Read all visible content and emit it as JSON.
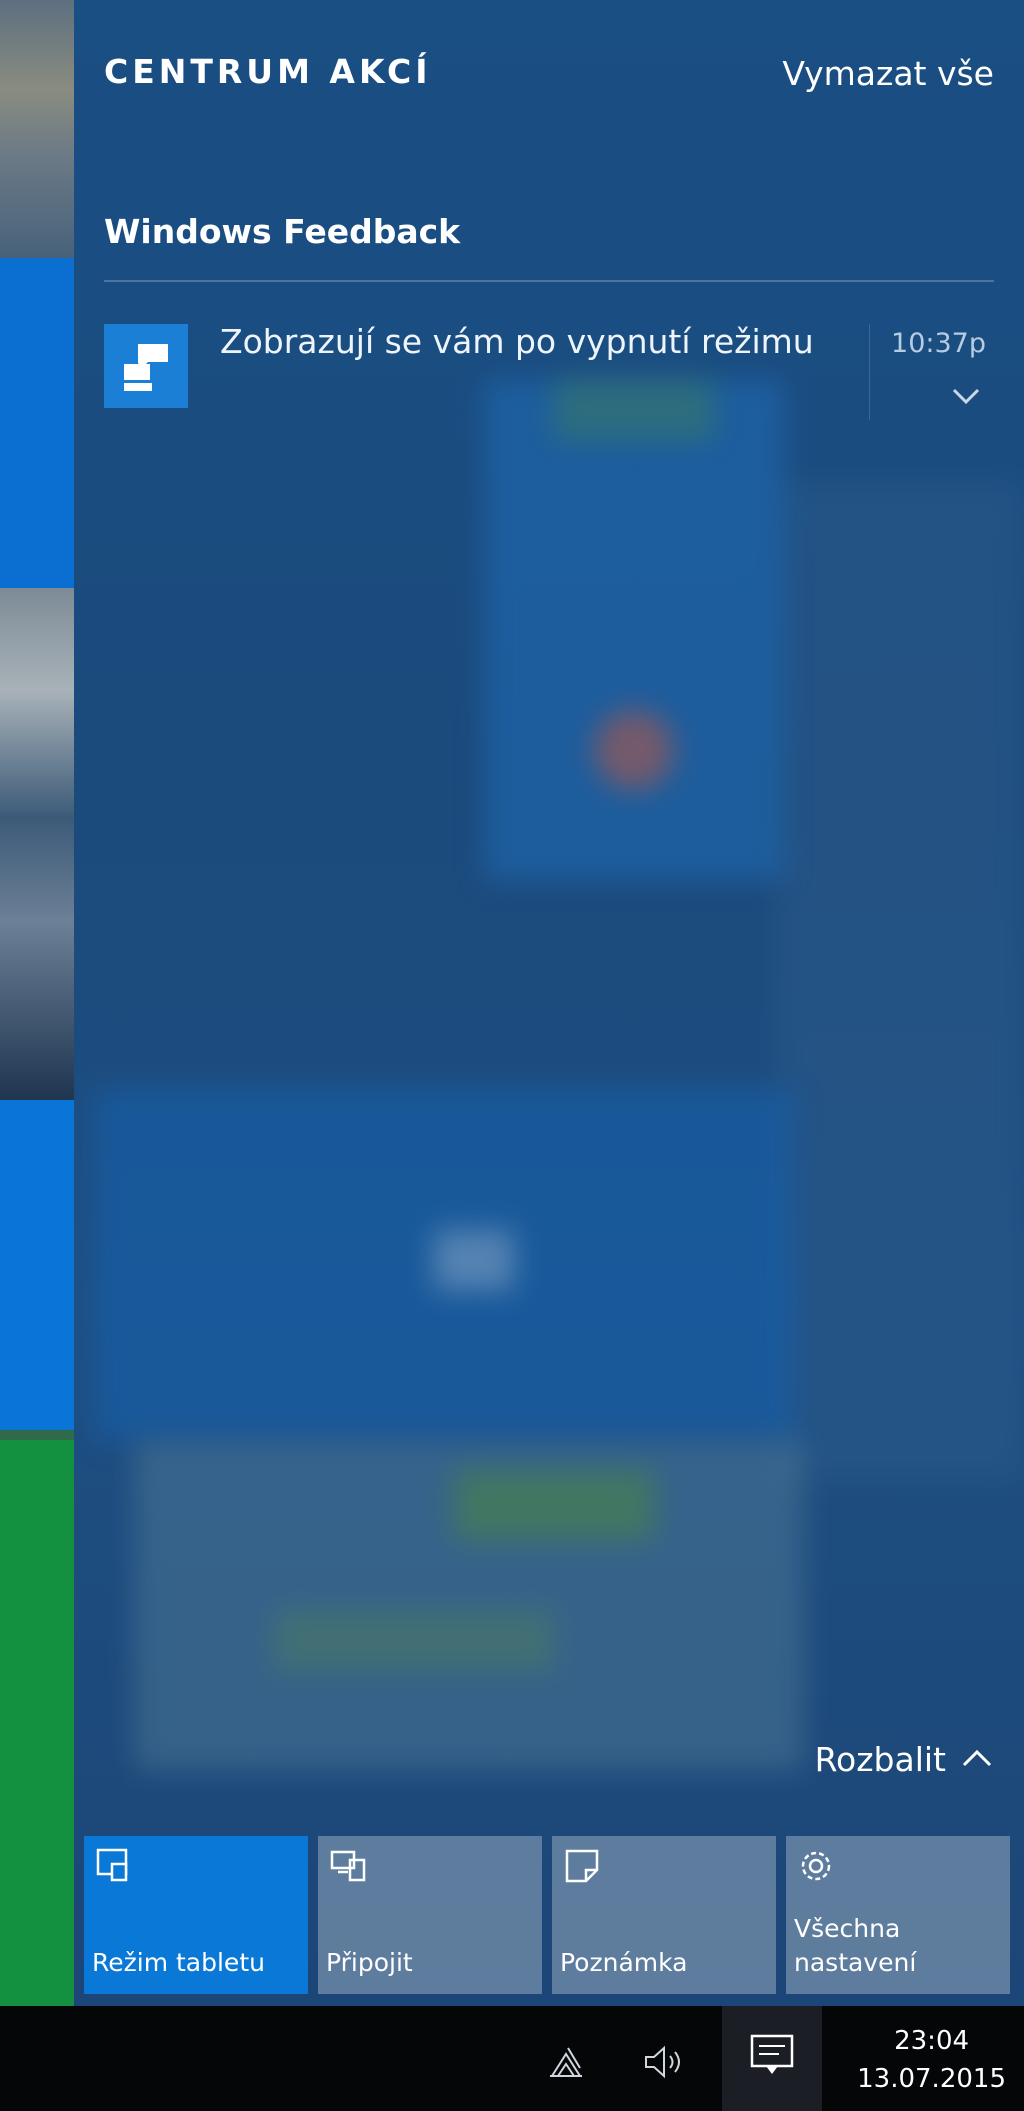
{
  "action_center": {
    "title": "CENTRUM AKCÍ",
    "clear_all_label": "Vymazat vše",
    "groups": [
      {
        "app_name": "Windows Feedback",
        "app_icon": "windows-feedback-icon",
        "notifications": [
          {
            "text": "Zobrazují se vám po vypnutí režimu",
            "time": "10:37p",
            "expand_icon": "chevron-down-icon"
          }
        ]
      }
    ],
    "expand_toggle": {
      "label": "Rozbalit",
      "icon": "chevron-up-icon"
    },
    "quick_actions": [
      {
        "label": "Režim tabletu",
        "icon": "tablet-mode-icon",
        "active": true
      },
      {
        "label": "Připojit",
        "icon": "connect-icon",
        "active": false
      },
      {
        "label": "Poznámka",
        "icon": "note-icon",
        "active": false
      },
      {
        "label": "Všechna nastavení",
        "icon": "gear-icon",
        "active": false
      }
    ]
  },
  "taskbar": {
    "tray_icons": [
      "network-icon",
      "volume-icon",
      "action-center-icon"
    ],
    "clock": {
      "time": "23:04",
      "date": "13.07.2015"
    }
  },
  "colors": {
    "panel_background": "#1b4a7c",
    "accent": "#0a78d6",
    "tile_inactive": "#7e96af",
    "taskbar": "#040608",
    "start_tile_green": "#139140"
  }
}
